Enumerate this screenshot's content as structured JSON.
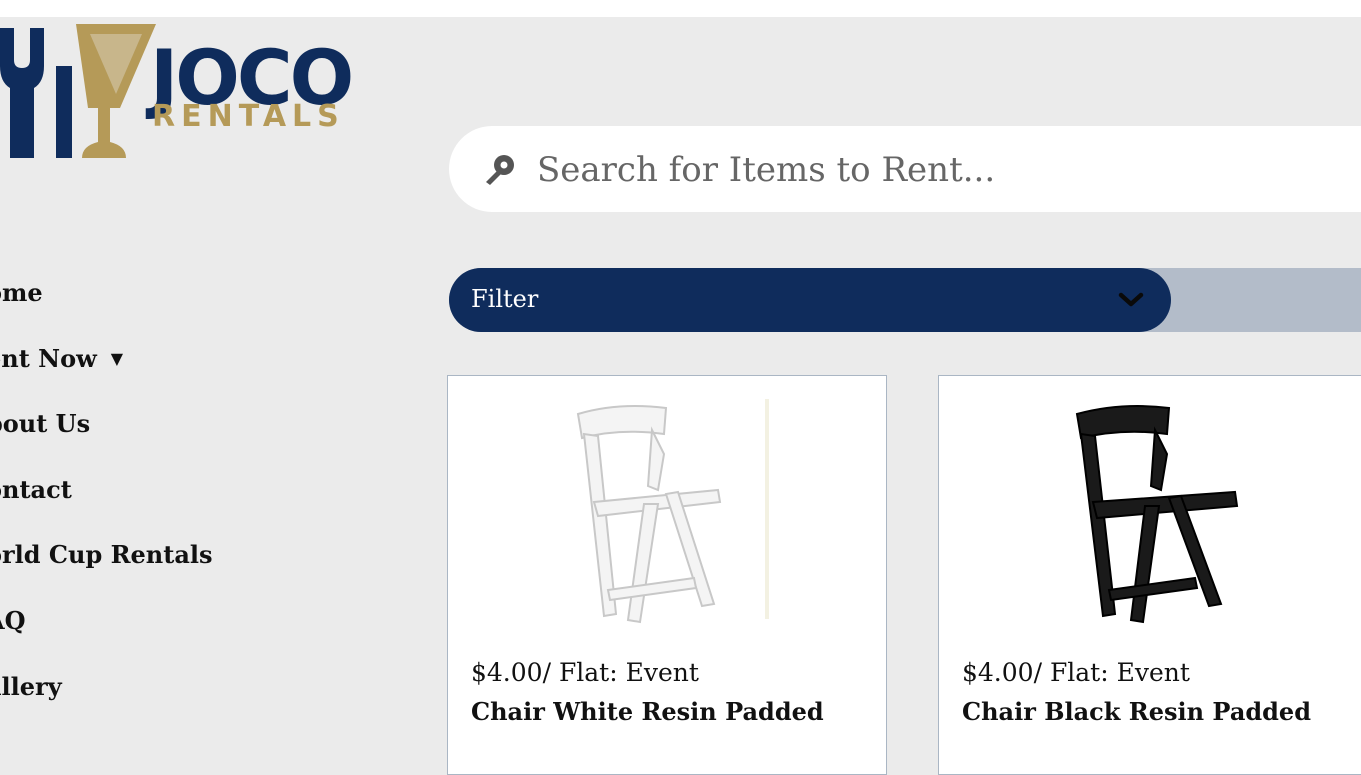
{
  "logo": {
    "line1": "JOCO",
    "line2": "RENTALS",
    "colors": {
      "navy": "#0f2c5c",
      "gold": "#b59a58"
    }
  },
  "nav": {
    "items": [
      {
        "label": "ome"
      },
      {
        "label": "ent Now",
        "caret": "▼"
      },
      {
        "label": "bout Us"
      },
      {
        "label": "ontact"
      },
      {
        "label": "orld Cup Rentals"
      },
      {
        "label": "AQ"
      },
      {
        "label": "allery"
      }
    ]
  },
  "search": {
    "placeholder": "Search for Items to Rent...",
    "icon": "search-icon"
  },
  "filter": {
    "label": "Filter",
    "icon": "chevron-down-icon",
    "color": "#0f2c5c"
  },
  "products": [
    {
      "price": "$4.00/ Flat: Event",
      "name": "Chair White Resin Padded",
      "chair_color": "#f4f4f4"
    },
    {
      "price": "$4.00/ Flat: Event",
      "name": "Chair Black Resin Padded",
      "chair_color": "#1a1a1a"
    }
  ]
}
